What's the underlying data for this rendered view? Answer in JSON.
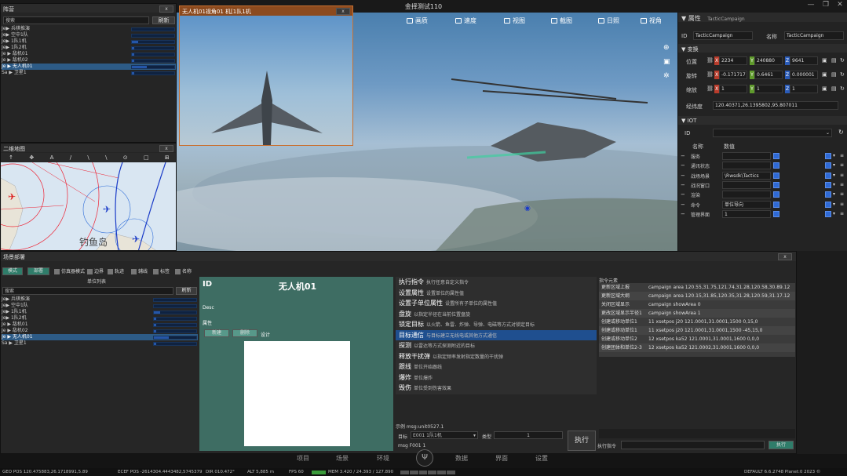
{
  "app": {
    "title": "金择测试110"
  },
  "toolbar": {
    "items": [
      {
        "label": "画质",
        "icon": "display-icon"
      },
      {
        "label": "速度",
        "icon": "speed-icon"
      },
      {
        "label": "视图",
        "icon": "view-icon"
      },
      {
        "label": "截图",
        "icon": "screenshot-icon"
      },
      {
        "label": "日照",
        "icon": "sun-icon"
      },
      {
        "label": "视角",
        "icon": "eye-icon"
      }
    ]
  },
  "camera_view": {
    "title": "无人机01视角01 机[1队1机"
  },
  "formation": {
    "title": "阵营",
    "search_placeholder": "搜索",
    "refresh": "刷新",
    "items": [
      {
        "label": "Je▶ 兵棋推演",
        "bar": 0
      },
      {
        "label": "  Je▶ 空中1队",
        "bar": 0
      },
      {
        "label": "    Je▶ 1队1机",
        "bar": 0.15
      },
      {
        "label": "    Je▶ 1队2机",
        "bar": 0.05
      },
      {
        "label": "Je ▶ 敌机01",
        "bar": 0.05
      },
      {
        "label": "Je ▶ 敌机02",
        "bar": 0.05
      },
      {
        "label": "Je ▶ 无人机01",
        "bar": 0.35,
        "selected": true
      },
      {
        "label": "Sa ▶ 卫星1",
        "bar": 0.05
      }
    ]
  },
  "map2d": {
    "title": "二维地图",
    "label": "钓鱼岛"
  },
  "properties": {
    "title": "属性",
    "header_value": "TacticCampaign",
    "id_label": "ID",
    "id_value": "TacticCampaign",
    "name_label": "名称",
    "name_value": "TacticCampaign",
    "transform_title": "变换",
    "rows": [
      {
        "label": "位置",
        "x": "2234",
        "y": "240880",
        "z": "9641"
      },
      {
        "label": "旋转",
        "x": "-0.171717",
        "y": "0.6461",
        "z": "0.000001"
      },
      {
        "label": "缩放",
        "x": "1",
        "y": "1",
        "z": "1"
      }
    ],
    "latlon_label": "经纬度",
    "latlon_value": "120.40371,26.1395802,95.807011",
    "iot_title": "IOT",
    "iot_id_label": "ID",
    "col_name": "名称",
    "col_value": "数值",
    "iot_rows": [
      {
        "name": "服务",
        "value": ""
      },
      {
        "name": "通讯状态",
        "value": ""
      },
      {
        "name": "战场场景",
        "value": "\\Rwsdk\\Tactics"
      },
      {
        "name": "战况窗口",
        "value": ""
      },
      {
        "name": "渲染",
        "value": ""
      },
      {
        "name": "命令",
        "value": "单位导向"
      },
      {
        "name": "管理界面",
        "value": "1"
      }
    ]
  },
  "scene_panel": {
    "title": "场景部署",
    "tab_selected": "模式",
    "tab_deploy": "部署",
    "filters": [
      "仿真器模式",
      "边界",
      "轨迹",
      "辅线",
      "标签",
      "名称"
    ],
    "unit_list_title": "单位列表",
    "search_placeholder": "搜索",
    "refresh": "刷新",
    "items": [
      {
        "label": "Je▶ 兵棋推演",
        "bar": 0
      },
      {
        "label": "  Je▶ 空中1队",
        "bar": 0
      },
      {
        "label": "    Je▶ 1队1机",
        "bar": 0.15
      },
      {
        "label": "    Je▶ 1队2机",
        "bar": 0.05
      },
      {
        "label": "Je ▶ 敌机01",
        "bar": 0.05
      },
      {
        "label": "Je ▶ 敌机02",
        "bar": 0.05
      },
      {
        "label": "Je ▶ 无人机01",
        "bar": 0.35,
        "selected": true
      },
      {
        "label": "Sa ▶ 卫星1",
        "bar": 0.05
      }
    ]
  },
  "detail": {
    "id_label": "ID",
    "name": "无人机01",
    "desc_label": "Desc",
    "attr_label": "属性",
    "btn_add": "新建",
    "btn_delete": "删除",
    "attr_text": "设计"
  },
  "commands": {
    "items": [
      {
        "name": "执行指令",
        "desc": "执行任意自定义指令"
      },
      {
        "name": "设置属性",
        "desc": "设置单位的属性值"
      },
      {
        "name": "设置子单位属性",
        "desc": "设置所有子单位的属性值"
      },
      {
        "name": "盘旋",
        "desc": "以指定半径在当前位置盘旋"
      },
      {
        "name": "锁定目标",
        "desc": "以火箭、鱼雷、炸弹、导弹、电磁等方式对锁定目标"
      },
      {
        "name": "目标通信",
        "desc": "与目标建立无线电或其他方式通信",
        "selected": true
      },
      {
        "name": "探测",
        "desc": "以雷达等方式探测附近的目标"
      },
      {
        "name": "释放干扰弹",
        "desc": "以指定频率发射指定数量的干扰弹"
      },
      {
        "name": "跟线",
        "desc": "单位开始跟线"
      },
      {
        "name": "爆炸",
        "desc": "单位爆炸"
      },
      {
        "name": "毁伤",
        "desc": "单位受到伤害效果"
      }
    ]
  },
  "command_form": {
    "example": "示例 msg:unit0527.1",
    "target_label": "目标",
    "target_value": "E001 1队1机",
    "type_label": "类型",
    "type_value": "1",
    "msg_value": "msg F001 1",
    "exec": "执行"
  },
  "log": {
    "title": "指令元素",
    "rows": [
      {
        "a": "更新区域上报",
        "b": "campaign area 120.55,31.75,121.74,31.28,120.58,30.89.12"
      },
      {
        "a": "更新区域大纲",
        "b": "campaign area 120.15,31.85,120.35,31.28,120.59,31.17.12"
      },
      {
        "a": "关闭区域显示",
        "b": "campaign showArea 0"
      },
      {
        "a": "更改区域显示半径1",
        "b": "campaign showArea 1"
      },
      {
        "a": "创建或移动单位1",
        "b": "11 xsetpos j20 121.0001,31.0001,1500 0,15,0"
      },
      {
        "a": "创建或移动单位1",
        "b": "11 xsetpos j20 121.0001,31.0001,1500 -45,15,0"
      },
      {
        "a": "创建或移动单位2",
        "b": "12 xsetpos ka52 121.0001,31.0001,1600 0,0,0"
      },
      {
        "a": "创建团体和单位2-3",
        "b": "12 xsetpos ka52 121.0002,31.0001,1600 0,0,0"
      }
    ],
    "cmd_label": "执行指令",
    "exec": "执行"
  },
  "nav": {
    "items": [
      "项目",
      "场景",
      "环境",
      "数据",
      "界面",
      "设置"
    ]
  },
  "status": {
    "geo": "GEO POS 120.475883,26.1718991,5.89",
    "ecef": "ECEF POS -2614304.4443482,5745379",
    "dir": "DIR 010.472°",
    "alt": "ALT 5,885 m",
    "fps": "FPS 60",
    "mem": "MEM 3.420 / 24.393 / 127.890",
    "right": "DEFAULT 6.6.2748  Planet:0 2023 ©"
  },
  "colors": {
    "accent": "#2d5b86",
    "green": "#2f7d6a"
  }
}
